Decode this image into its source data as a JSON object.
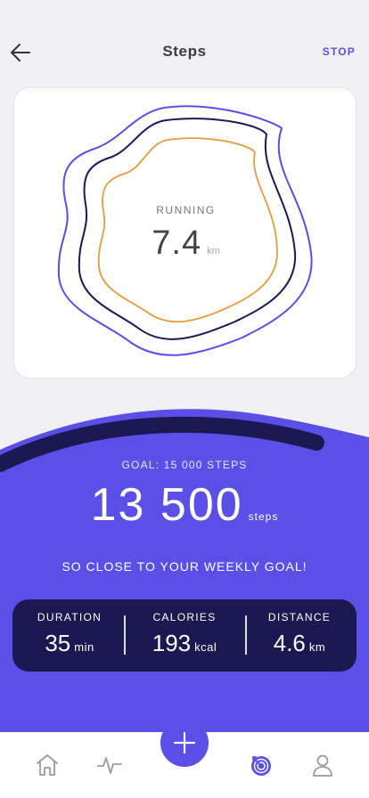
{
  "header": {
    "title": "Steps",
    "stop_label": "STOP",
    "back_icon": "arrow-left-icon"
  },
  "activity": {
    "label": "RUNNING",
    "value": "7.4",
    "unit": "km"
  },
  "goal": {
    "label": "GOAL: 15 000 STEPS",
    "steps_value": "13 500",
    "steps_unit": "steps",
    "progress_fraction": 0.9,
    "message": "SO CLOSE TO YOUR WEEKLY GOAL!"
  },
  "stats": [
    {
      "label": "DURATION",
      "value": "35",
      "unit": "min"
    },
    {
      "label": "CALORIES",
      "value": "193",
      "unit": "kcal"
    },
    {
      "label": "DISTANCE",
      "value": "4.6",
      "unit": "km"
    }
  ],
  "nav": {
    "items": [
      {
        "icon": "home-icon",
        "active": false
      },
      {
        "icon": "activity-icon",
        "active": false
      },
      {
        "icon": "target-icon",
        "active": true
      },
      {
        "icon": "profile-icon",
        "active": false
      }
    ],
    "fab_icon": "plus-icon"
  },
  "colors": {
    "accent": "#5a4fe6",
    "dark": "#1b1852",
    "orange": "#e89a3c",
    "background": "#f1f0f4"
  }
}
